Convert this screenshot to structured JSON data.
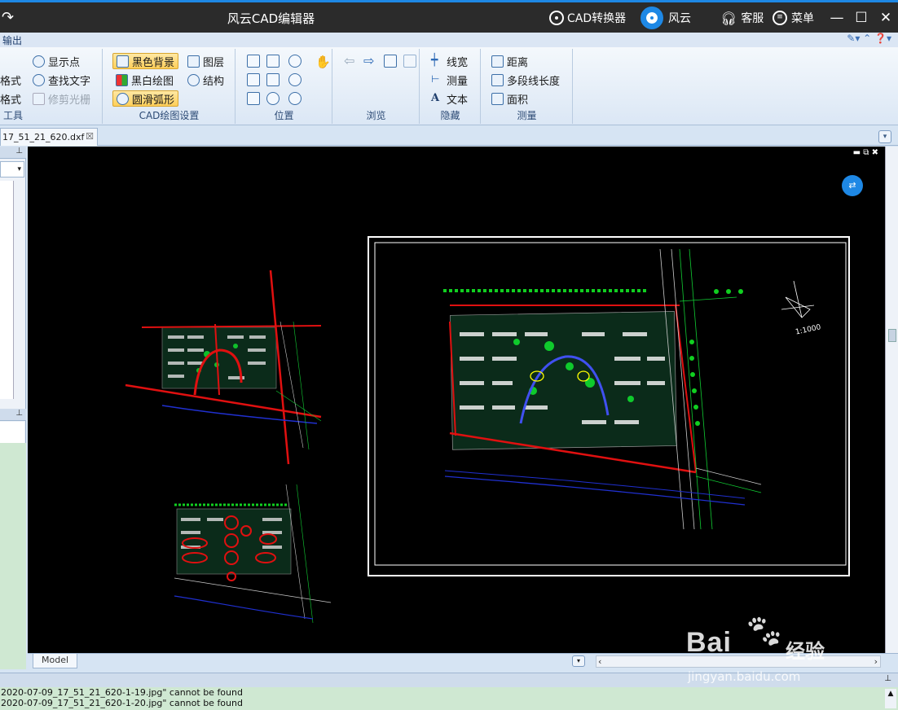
{
  "window": {
    "title": "风云CAD编辑器",
    "converter_label": "CAD转换器",
    "brand_label": "风云",
    "service_label": "客服",
    "menu_label": "菜单"
  },
  "ribbon": {
    "tab_label": "输出",
    "groups": {
      "tools": {
        "label": "工具",
        "left_frag_1": "格式",
        "left_frag_2": "格式",
        "show_point": "显示点",
        "find_text": "查找文字",
        "trim_raster": "修剪光栅"
      },
      "settings": {
        "label": "CAD绘图设置",
        "black_bg": "黑色背景",
        "bw_draw": "黑白绘图",
        "smooth_arc": "圆滑弧形",
        "layers": "图层",
        "structure": "结构"
      },
      "position": {
        "label": "位置"
      },
      "browse": {
        "label": "浏览"
      },
      "hide": {
        "label": "隐藏",
        "line_width": "线宽",
        "measure": "测量",
        "text": "文本"
      },
      "measure": {
        "label": "测量",
        "distance": "距离",
        "polyline_length": "多段线长度",
        "area": "面积"
      }
    }
  },
  "document_tab": {
    "filename": "17_51_21_620.dxf"
  },
  "canvas": {
    "scale_text": "1:1000",
    "model_tab": "Model"
  },
  "output": {
    "lines": [
      "2020-07-09_17_51_21_620-1-19.jpg\" cannot be found",
      "2020-07-09_17_51_21_620-1-20.jpg\" cannot be found"
    ]
  },
  "watermark": {
    "brand": "Bai",
    "product": "经验",
    "url": "jingyan.baidu.com"
  },
  "colors": {
    "accent": "#1e88e5",
    "canvas_bg": "#000000",
    "road": "#e01010",
    "green": "#10d020"
  }
}
